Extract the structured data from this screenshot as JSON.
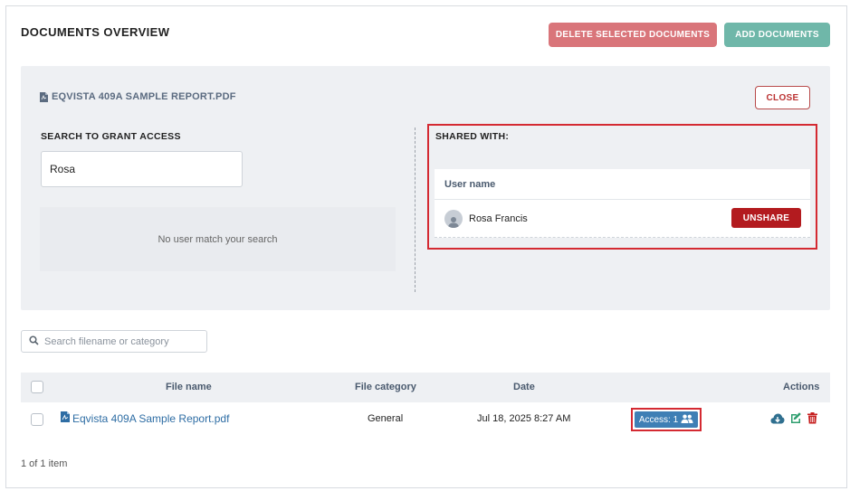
{
  "header": {
    "title": "DOCUMENTS OVERVIEW",
    "delete_label": "DELETE SELECTED DOCUMENTS",
    "add_label": "ADD DOCUMENTS"
  },
  "panel": {
    "document_title": "EQVISTA 409A SAMPLE REPORT.PDF",
    "close_label": "CLOSE",
    "search_label": "SEARCH TO GRANT ACCESS",
    "search_value": "Rosa",
    "no_match_text": "No user match your search",
    "shared_label": "SHARED WITH:",
    "shared_column": "User name",
    "shared_users": [
      {
        "name": "Rosa Francis",
        "action_label": "UNSHARE"
      }
    ]
  },
  "files": {
    "search_placeholder": "Search filename or category",
    "columns": {
      "file_name": "File name",
      "file_category": "File category",
      "date": "Date",
      "actions": "Actions"
    },
    "rows": [
      {
        "file_name": "Eqvista 409A Sample Report.pdf",
        "category": "General",
        "date": "Jul 18, 2025 8:27 AM",
        "access_label": "Access: 1"
      }
    ],
    "pagination": "1 of 1 item"
  },
  "colors": {
    "delete_button": "#d9757a",
    "add_button": "#6fb7a9",
    "unshare_button": "#b31b1f",
    "access_button": "#3f7fb5",
    "highlight_border": "#d42a32",
    "link": "#2e6da4"
  },
  "icons": {
    "document": "pdf-file-icon",
    "search": "search-icon",
    "avatar": "user-avatar-icon",
    "access": "users-icon",
    "download": "cloud-download-icon",
    "edit": "edit-icon",
    "delete": "trash-icon"
  }
}
